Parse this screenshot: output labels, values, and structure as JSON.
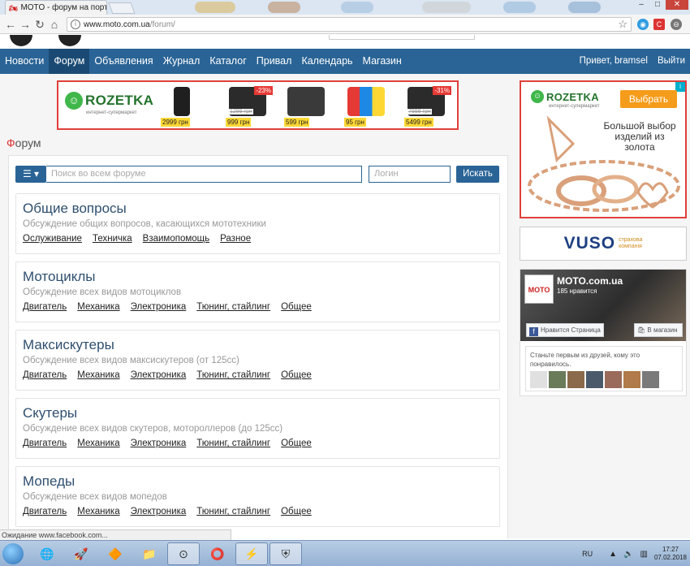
{
  "browser": {
    "tab_title": "MOTO - форум на порт",
    "url_host": "www.moto.com.ua",
    "url_path": "/forum/",
    "status_text": "Ожидание www.facebook.com..."
  },
  "nav": {
    "items": [
      "Новости",
      "Форум",
      "Объявления",
      "Журнал",
      "Каталог",
      "Привал",
      "Календарь",
      "Магазин"
    ],
    "active": "Форум",
    "greeting": "Привет, bramsel",
    "logout": "Выйти"
  },
  "top_ad": {
    "brand": "ROZETKA",
    "brand_sub": "интернет-супермаркет",
    "products": [
      {
        "price": "2999 грн",
        "old_price": "",
        "discount": ""
      },
      {
        "price": "999 грн",
        "old_price": "1299 грн",
        "discount": "-23%"
      },
      {
        "price": "599 грн",
        "old_price": "",
        "discount": ""
      },
      {
        "price": "95 грн",
        "old_price": "",
        "discount": ""
      },
      {
        "price": "5499 грн",
        "old_price": "7999 грн",
        "discount": "-31%"
      }
    ]
  },
  "forum": {
    "heading_first": "Ф",
    "heading_rest": "орум",
    "search_placeholder": "Поиск во всем форуме",
    "login_placeholder": "Логин",
    "search_button": "Искать",
    "categories": [
      {
        "title": "Общие вопросы",
        "desc": "Обсуждение общих вопросов, касающихся мототехники",
        "links": [
          "Ослуживание",
          "Техничка",
          "Взаимопомощь",
          "Разное"
        ]
      },
      {
        "title": "Мотоциклы",
        "desc": "Обсуждение всех видов мотоциклов",
        "links": [
          "Двигатель",
          "Механика",
          "Электроника",
          "Тюнинг, стайлинг",
          "Общее"
        ]
      },
      {
        "title": "Максискутеры",
        "desc": "Обсуждение всех видов максискутеров (от 125сс)",
        "links": [
          "Двигатель",
          "Механика",
          "Электроника",
          "Тюнинг, стайлинг",
          "Общее"
        ]
      },
      {
        "title": "Скутеры",
        "desc": "Обсуждение всех видов скутеров, мотороллеров (до 125сс)",
        "links": [
          "Двигатель",
          "Механика",
          "Электроника",
          "Тюнинг, стайлинг",
          "Общее"
        ]
      },
      {
        "title": "Мопеды",
        "desc": "Обсуждение всех видов мопедов",
        "links": [
          "Двигатель",
          "Механика",
          "Электроника",
          "Тюнинг, стайлинг",
          "Общее"
        ]
      }
    ]
  },
  "side_ad": {
    "brand": "ROZETKA",
    "brand_sub": "интернет-супермаркет",
    "button": "Выбрать",
    "tagline": "Большой выбор изделий из золота"
  },
  "vuso": {
    "word": "VUSO",
    "sub1": "страхова",
    "sub2": "компанія"
  },
  "facebook": {
    "page_name": "MOTO.com.ua",
    "likes": "185 нравится",
    "like_button": "Нравится Страница",
    "shop_button": "В магазин",
    "friends_text": "Станьте первым из друзей, кому это понравилось."
  },
  "taskbar": {
    "lang": "RU",
    "time": "17:27",
    "date": "07.02.2018"
  },
  "colors": {
    "nav": "#2a6496",
    "accent_red": "#e0403a",
    "rozetka_green": "#3fb74a"
  }
}
